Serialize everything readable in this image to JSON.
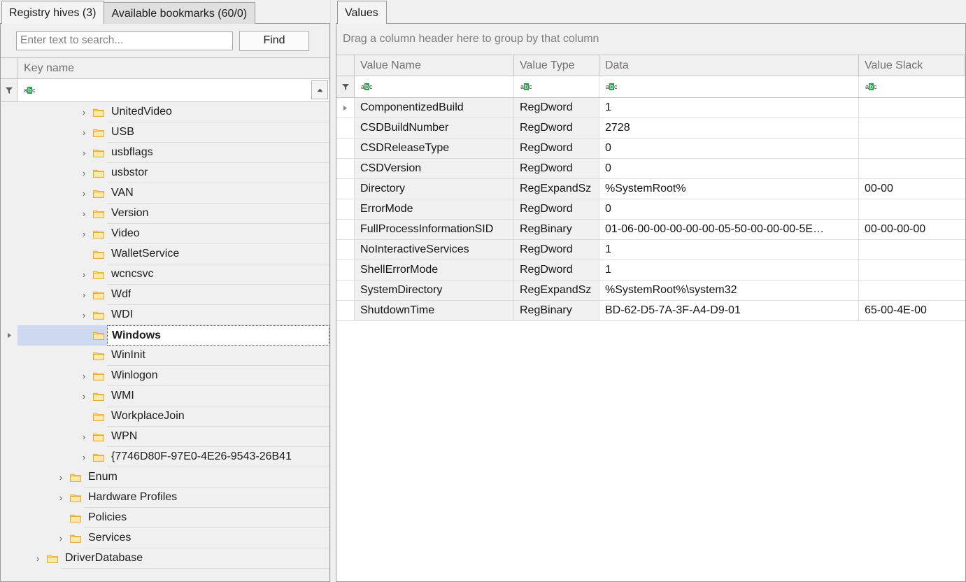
{
  "left": {
    "tabs": [
      {
        "label": "Registry hives (3)",
        "active": true
      },
      {
        "label": "Available bookmarks (60/0)",
        "active": false
      }
    ],
    "search": {
      "placeholder": "Enter text to search...",
      "value": "",
      "find_label": "Find"
    },
    "column_header": "Key name",
    "filter_glyph": {
      "left": "a",
      "mid": "b",
      "right": "c"
    },
    "tree": [
      {
        "label": "UnitedVideo",
        "indent": 2,
        "expandable": true,
        "selected": false
      },
      {
        "label": "USB",
        "indent": 2,
        "expandable": true,
        "selected": false
      },
      {
        "label": "usbflags",
        "indent": 2,
        "expandable": true,
        "selected": false
      },
      {
        "label": "usbstor",
        "indent": 2,
        "expandable": true,
        "selected": false
      },
      {
        "label": "VAN",
        "indent": 2,
        "expandable": true,
        "selected": false
      },
      {
        "label": "Version",
        "indent": 2,
        "expandable": true,
        "selected": false
      },
      {
        "label": "Video",
        "indent": 2,
        "expandable": true,
        "selected": false
      },
      {
        "label": "WalletService",
        "indent": 2,
        "expandable": false,
        "selected": false
      },
      {
        "label": "wcncsvc",
        "indent": 2,
        "expandable": true,
        "selected": false
      },
      {
        "label": "Wdf",
        "indent": 2,
        "expandable": true,
        "selected": false
      },
      {
        "label": "WDI",
        "indent": 2,
        "expandable": true,
        "selected": false
      },
      {
        "label": "Windows",
        "indent": 2,
        "expandable": false,
        "selected": true
      },
      {
        "label": "WinInit",
        "indent": 2,
        "expandable": false,
        "selected": false
      },
      {
        "label": "Winlogon",
        "indent": 2,
        "expandable": true,
        "selected": false
      },
      {
        "label": "WMI",
        "indent": 2,
        "expandable": true,
        "selected": false
      },
      {
        "label": "WorkplaceJoin",
        "indent": 2,
        "expandable": false,
        "selected": false
      },
      {
        "label": "WPN",
        "indent": 2,
        "expandable": true,
        "selected": false
      },
      {
        "label": "{7746D80F-97E0-4E26-9543-26B41",
        "indent": 2,
        "expandable": true,
        "selected": false
      },
      {
        "label": "Enum",
        "indent": 1,
        "expandable": true,
        "selected": false
      },
      {
        "label": "Hardware Profiles",
        "indent": 1,
        "expandable": true,
        "selected": false
      },
      {
        "label": "Policies",
        "indent": 1,
        "expandable": false,
        "selected": false
      },
      {
        "label": "Services",
        "indent": 1,
        "expandable": true,
        "selected": false
      },
      {
        "label": "DriverDatabase",
        "indent": 0,
        "expandable": true,
        "selected": false
      }
    ]
  },
  "right": {
    "tabs": [
      {
        "label": "Values",
        "active": true
      }
    ],
    "group_bar_text": "Drag a column header here to group by that column",
    "columns": [
      "Value Name",
      "Value Type",
      "Data",
      "Value Slack"
    ],
    "filter_glyph": {
      "left": "a",
      "mid": "b",
      "right": "c"
    },
    "rows": [
      {
        "name": "ComponentizedBuild",
        "type": "RegDword",
        "data": "1",
        "slack": "",
        "expandable": true
      },
      {
        "name": "CSDBuildNumber",
        "type": "RegDword",
        "data": "2728",
        "slack": "",
        "expandable": false
      },
      {
        "name": "CSDReleaseType",
        "type": "RegDword",
        "data": "0",
        "slack": "",
        "expandable": false
      },
      {
        "name": "CSDVersion",
        "type": "RegDword",
        "data": "0",
        "slack": "",
        "expandable": false
      },
      {
        "name": "Directory",
        "type": "RegExpandSz",
        "data": "%SystemRoot%",
        "slack": "00-00",
        "expandable": false
      },
      {
        "name": "ErrorMode",
        "type": "RegDword",
        "data": "0",
        "slack": "",
        "expandable": false
      },
      {
        "name": "FullProcessInformationSID",
        "type": "RegBinary",
        "data": "01-06-00-00-00-00-00-05-50-00-00-00-5E…",
        "slack": "00-00-00-00",
        "expandable": false
      },
      {
        "name": "NoInteractiveServices",
        "type": "RegDword",
        "data": "1",
        "slack": "",
        "expandable": false
      },
      {
        "name": "ShellErrorMode",
        "type": "RegDword",
        "data": "1",
        "slack": "",
        "expandable": false
      },
      {
        "name": "SystemDirectory",
        "type": "RegExpandSz",
        "data": "%SystemRoot%\\system32",
        "slack": "",
        "expandable": false
      },
      {
        "name": "ShutdownTime",
        "type": "RegBinary",
        "data": "BD-62-D5-7A-3F-A4-D9-01",
        "slack": "65-00-4E-00",
        "expandable": false
      }
    ]
  },
  "colors": {
    "selection": "#ccd9f0",
    "folder": "#ffd77a",
    "folder_border": "#e0a83c",
    "filter_badge": "#2e9e4e",
    "header_text": "#707070",
    "pane_bg": "#f0f0f0"
  }
}
